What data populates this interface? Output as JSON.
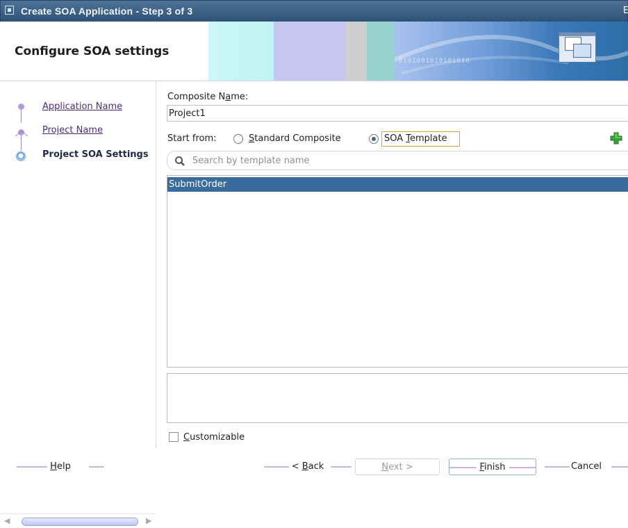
{
  "window": {
    "title": "Create SOA Application - Step 3 of 3",
    "maximize_glyph": "E"
  },
  "header": {
    "heading": "Configure SOA settings",
    "binary_text": "0101001010101010"
  },
  "steps": [
    {
      "label": "Application Name",
      "state": "link"
    },
    {
      "label": "Project Name",
      "state": "link"
    },
    {
      "label": "Project SOA Settings",
      "state": "current"
    }
  ],
  "form": {
    "composite_label_pre": "Composite N",
    "composite_label_mn": "a",
    "composite_label_post": "me:",
    "composite_value": "Project1",
    "start_from_label": "Start from:",
    "option1_mn": "S",
    "option1_rest": "tandard Composite",
    "option2_pre": "SOA ",
    "option2_mn": "T",
    "option2_post": "emplate",
    "selected_option": "SOA Template",
    "search_placeholder": "Search by template name",
    "templates": [
      "SubmitOrder"
    ],
    "customizable_mn": "C",
    "customizable_rest": "ustomizable",
    "customizable_checked": false
  },
  "buttons": {
    "help_mn": "H",
    "help_rest": "elp",
    "back_pre": "< ",
    "back_mn": "B",
    "back_rest": "ack",
    "next_mn": "N",
    "next_rest": "ext >",
    "finish_mn": "F",
    "finish_rest": "inish",
    "cancel": "Cancel"
  },
  "colors": {
    "title_bar": "#3c6187",
    "selection": "#3b6a9c",
    "link": "#4c2a7c",
    "focus_border": "#e3a14a",
    "add_icon": "#2f9e2f"
  },
  "icons": {
    "add": "green-plus-icon",
    "search": "magnifier-icon",
    "wizard": "wizard-windows-icon"
  }
}
